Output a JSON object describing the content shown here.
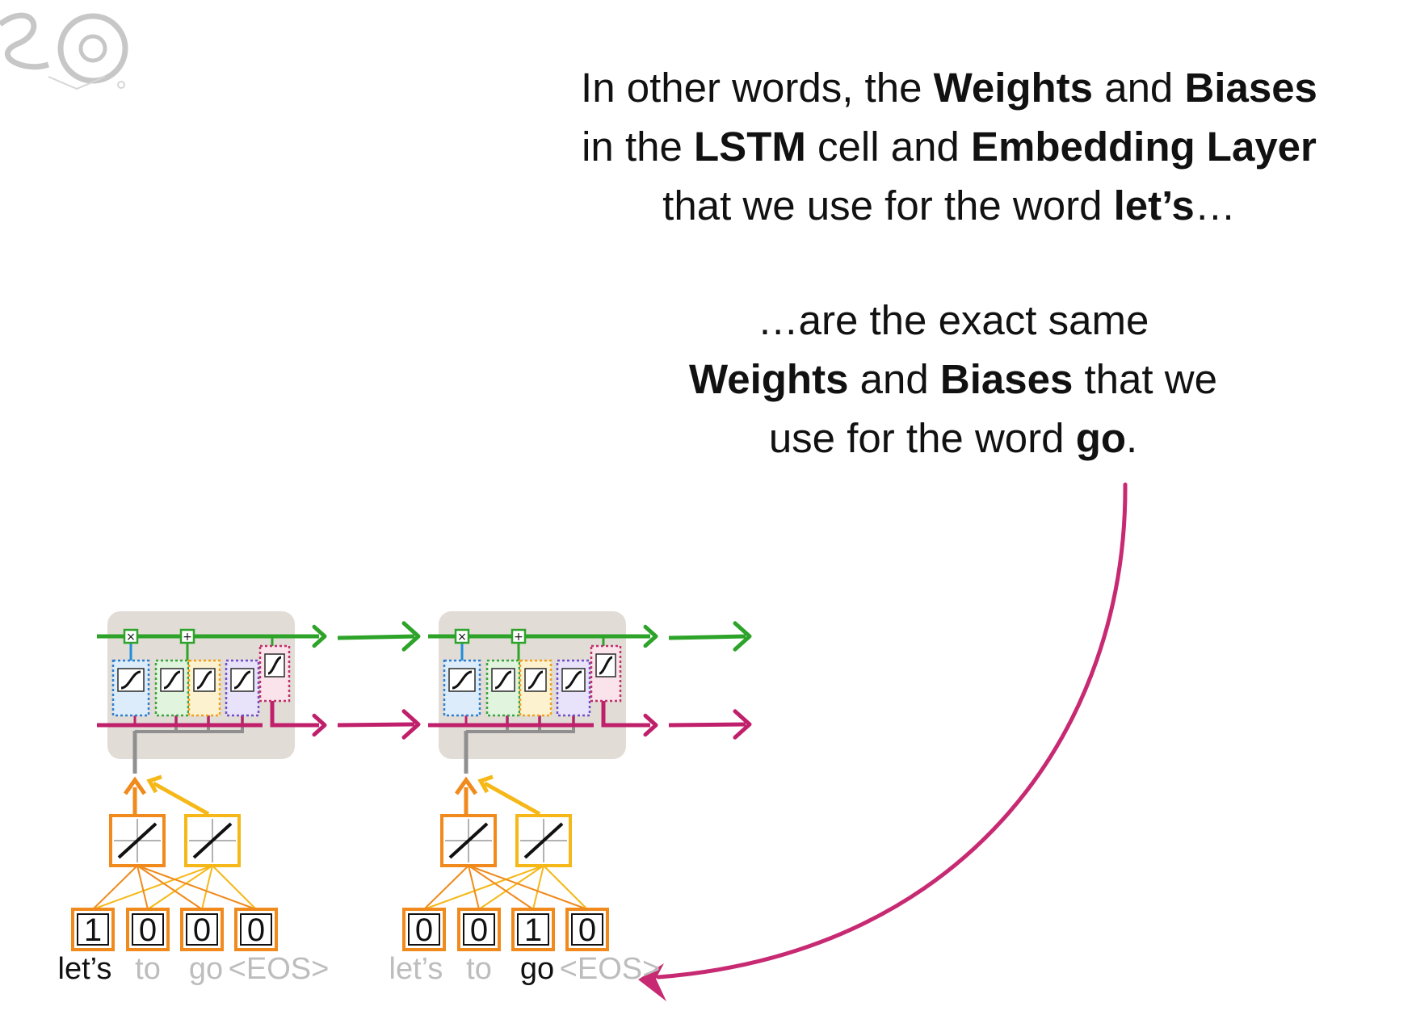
{
  "text": {
    "p1_line1": [
      {
        "t": "In other words, the ",
        "b": false
      },
      {
        "t": "Weights",
        "b": true
      },
      {
        "t": " and ",
        "b": false
      },
      {
        "t": "Biases",
        "b": true
      }
    ],
    "p1_line2": [
      {
        "t": "in the ",
        "b": false
      },
      {
        "t": "LSTM",
        "b": true
      },
      {
        "t": " cell and ",
        "b": false
      },
      {
        "t": "Embedding Layer",
        "b": true
      }
    ],
    "p1_line3": [
      {
        "t": "that we use for the word ",
        "b": false
      },
      {
        "t": "let’s",
        "b": true
      },
      {
        "t": "…",
        "b": false
      }
    ],
    "p2_line1": [
      {
        "t": "…are the exact same",
        "b": false
      }
    ],
    "p2_line2": [
      {
        "t": "Weights",
        "b": true
      },
      {
        "t": " and ",
        "b": false
      },
      {
        "t": "Biases",
        "b": true
      },
      {
        "t": " that we",
        "b": false
      }
    ],
    "p2_line3": [
      {
        "t": "use for the word ",
        "b": false
      },
      {
        "t": "go",
        "b": true
      },
      {
        "t": ".",
        "b": false
      }
    ]
  },
  "units": [
    {
      "inputs": [
        "1",
        "0",
        "0",
        "0"
      ],
      "words": [
        {
          "w": "let’s",
          "active": true
        },
        {
          "w": "to",
          "active": false
        },
        {
          "w": "go",
          "active": false
        },
        {
          "w": "<EOS>",
          "active": false
        }
      ]
    },
    {
      "inputs": [
        "0",
        "0",
        "1",
        "0"
      ],
      "words": [
        {
          "w": "let’s",
          "active": false
        },
        {
          "w": "to",
          "active": false
        },
        {
          "w": "go",
          "active": true
        },
        {
          "w": "<EOS>",
          "active": false
        }
      ]
    }
  ],
  "colors": {
    "cell_state": "#2ea32a",
    "short_term": "#c0206b",
    "embedding_1": "#f08a1c",
    "embedding_2": "#f5b818",
    "cell_bg": "#e2dcd6",
    "inactive_word": "#bdbdbd",
    "arrow": "#c72a72"
  }
}
